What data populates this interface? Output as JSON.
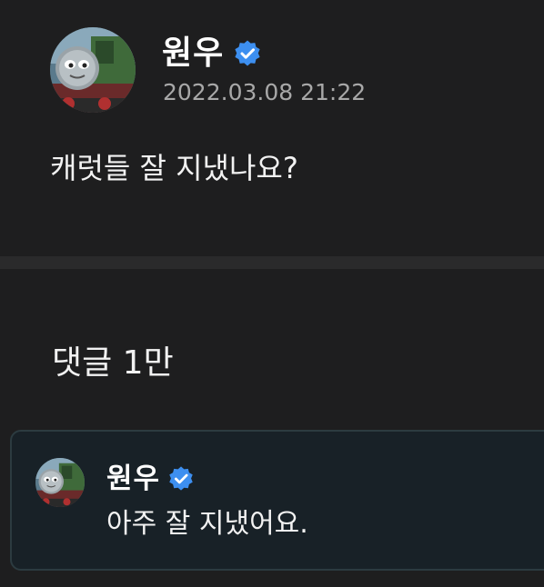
{
  "post": {
    "author": "원우",
    "timestamp": "2022.03.08 21:22",
    "body": "캐럿들 잘 지냈나요?",
    "avatar_icon": "avatar-train-image",
    "verified_icon": "verified-badge-icon"
  },
  "comments": {
    "header": "댓글 1만",
    "items": [
      {
        "author": "원우",
        "text": "아주 잘 지냈어요.",
        "avatar_icon": "avatar-train-image",
        "verified_icon": "verified-badge-icon"
      }
    ]
  },
  "colors": {
    "background": "#1e1e1f",
    "divider": "#2a2a2b",
    "comment_card": "#182127",
    "comment_border": "#2c3b40",
    "verified": "#3d8ff0",
    "timestamp": "#a8a8a8"
  }
}
